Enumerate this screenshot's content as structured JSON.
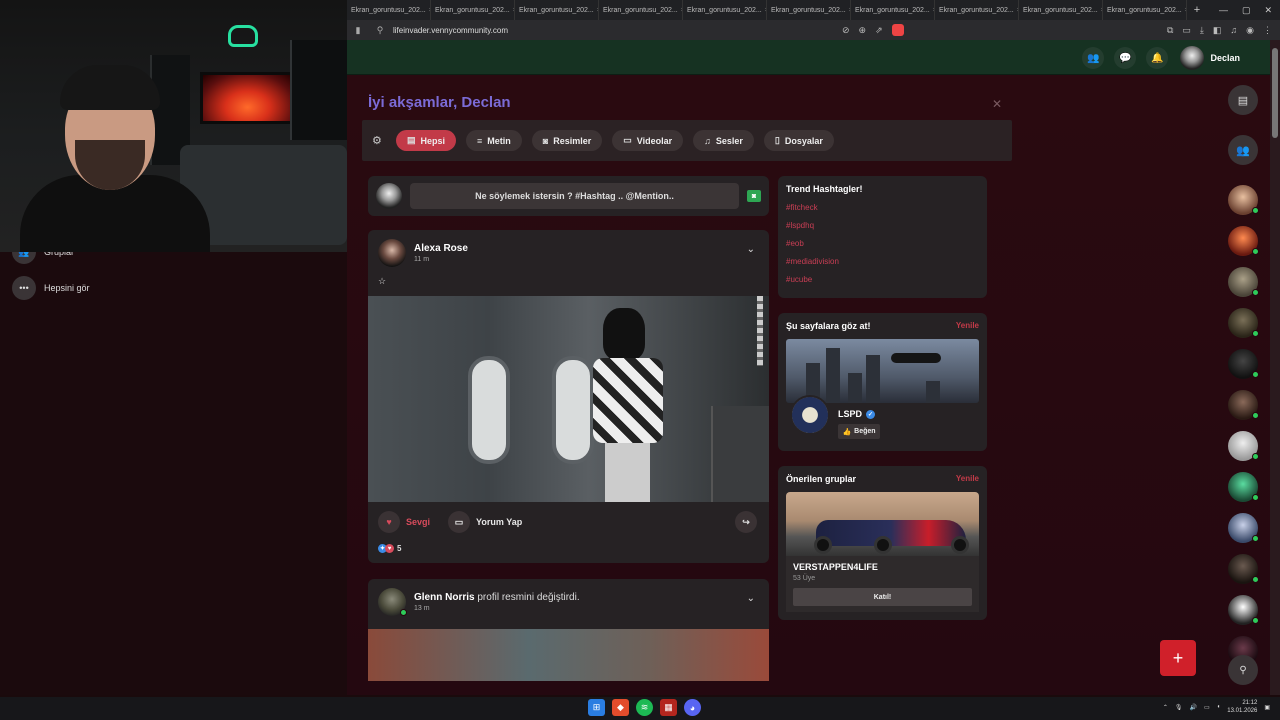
{
  "browser": {
    "tabs": [
      "Ekran_goruntusu_202...",
      "Ekran_goruntusu_202...",
      "Ekran_goruntusu_202...",
      "Ekran_goruntusu_202...",
      "Ekran_goruntusu_202...",
      "Ekran_goruntusu_202...",
      "Ekran_goruntusu_202...",
      "Ekran_goruntusu_202...",
      "Ekran_goruntusu_202...",
      "Ekran_goruntusu_202..."
    ],
    "url": "lifeinvader.vennycommunity.com"
  },
  "header": {
    "user_name": "Declan"
  },
  "sidebar": {
    "items": [
      {
        "label": "Gruplar",
        "icon": "group-icon"
      },
      {
        "label": "Hepsini gör",
        "icon": "more-icon"
      }
    ]
  },
  "main": {
    "greeting": "İyi akşamlar, Declan",
    "filters": [
      {
        "label": "Hepsi",
        "icon": "document-icon",
        "active": true
      },
      {
        "label": "Metin",
        "icon": "text-icon",
        "active": false
      },
      {
        "label": "Resimler",
        "icon": "camera-icon",
        "active": false
      },
      {
        "label": "Videolar",
        "icon": "video-icon",
        "active": false
      },
      {
        "label": "Sesler",
        "icon": "music-icon",
        "active": false
      },
      {
        "label": "Dosyalar",
        "icon": "file-icon",
        "active": false
      }
    ],
    "composer_placeholder": "Ne söylemek istersin ? #Hashtag .. @Mention..",
    "posts": [
      {
        "author": "Alexa Rose",
        "time": "11 m",
        "text": "☆",
        "like_label": "Sevgi",
        "comment_label": "Yorum Yap",
        "reaction_count": "5"
      },
      {
        "author": "Glenn Norris",
        "action": "profil resmini değiştirdi.",
        "time": "13 m"
      }
    ]
  },
  "widgets": {
    "trending": {
      "title": "Trend Hashtagler!",
      "tags": [
        "#fitcheck",
        "#lspdhq",
        "#eob",
        "#mediadivision",
        "#ucube"
      ]
    },
    "pages": {
      "title": "Şu sayfalara göz at!",
      "refresh": "Yenile",
      "page_name": "LSPD",
      "like_label": "Beğen"
    },
    "groups": {
      "title": "Önerilen gruplar",
      "refresh": "Yenile",
      "group_name": "VERSTAPPEN4LIFE",
      "members": "53 Üye",
      "join_label": "Katıl!"
    }
  },
  "taskbar": {
    "time": "21:12",
    "date": "13.01.2026"
  },
  "colors": {
    "accent": "#c23a48",
    "header_bg": "#163222",
    "greeting": "#7b6bd6",
    "online": "#2ecc5a"
  }
}
